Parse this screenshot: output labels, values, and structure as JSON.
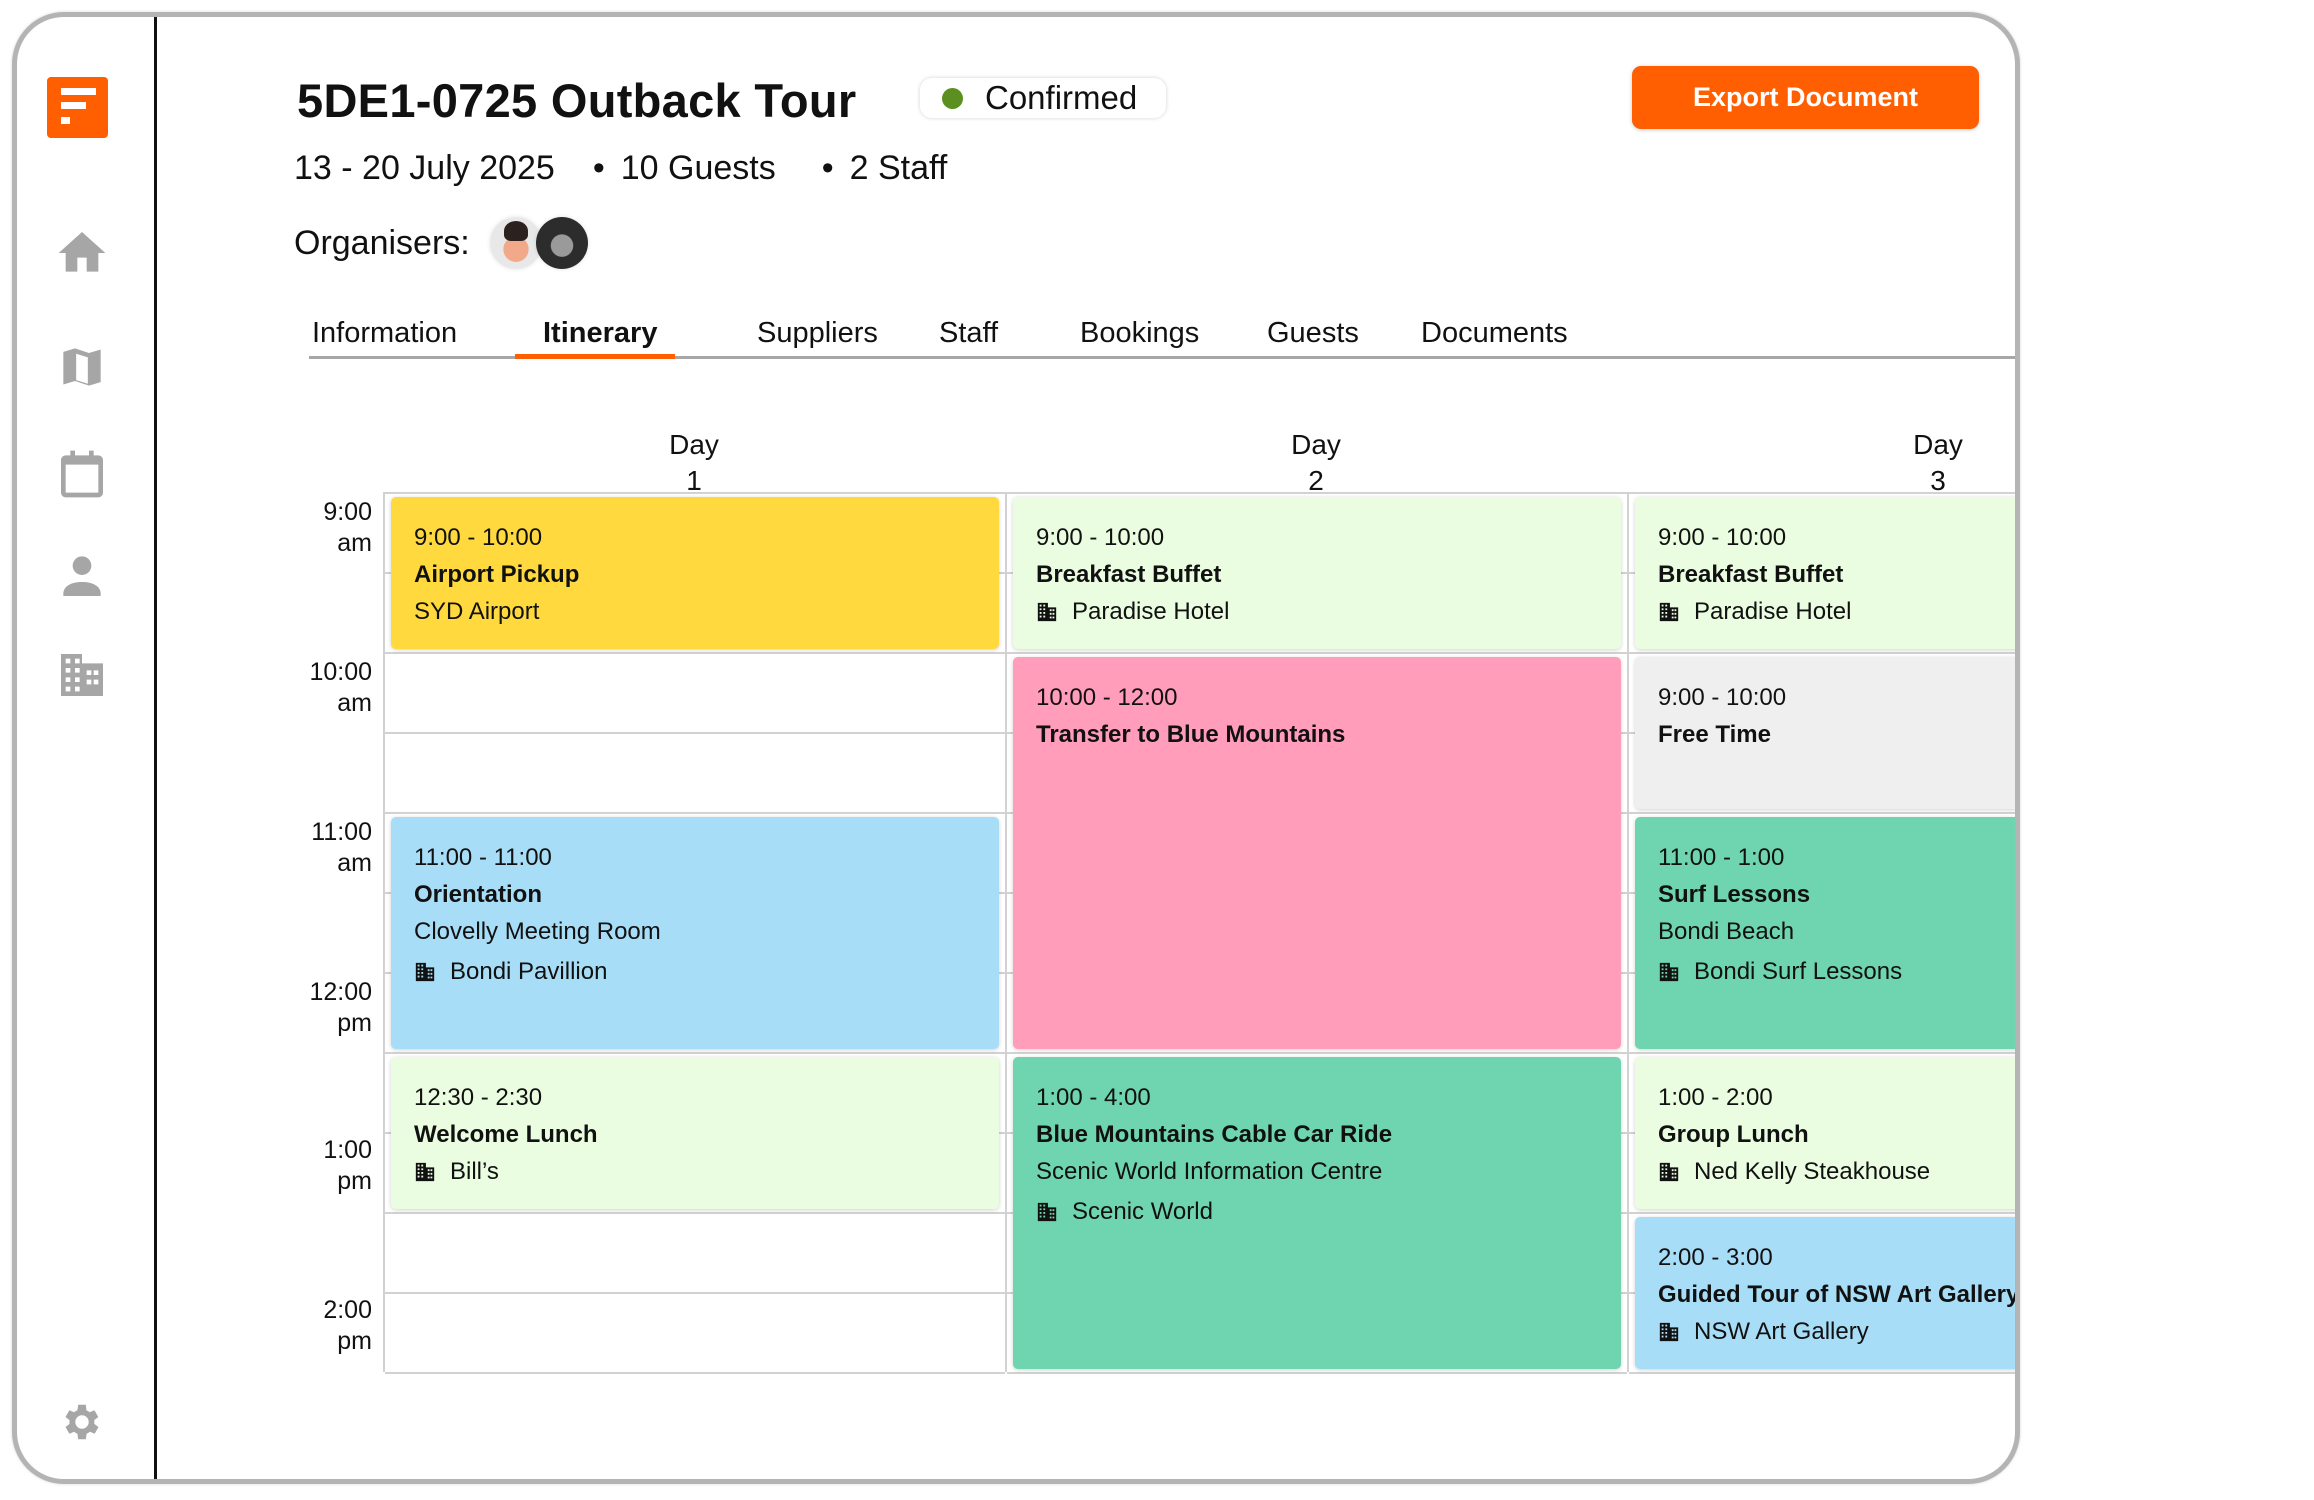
{
  "sidebar": {
    "logo": "brand-logo",
    "items": [
      {
        "name": "home",
        "icon": "home-icon"
      },
      {
        "name": "map",
        "icon": "map-icon"
      },
      {
        "name": "calendar",
        "icon": "calendar-icon"
      },
      {
        "name": "people",
        "icon": "person-icon"
      },
      {
        "name": "suppliers",
        "icon": "building-icon"
      }
    ],
    "settings_icon": "gear-icon"
  },
  "header": {
    "title": "5DE1-0725 Outback Tour",
    "status": {
      "label": "Confirmed",
      "color": "#5b8f1f"
    },
    "dates": "13 - 20 July 2025",
    "guests": "10 Guests",
    "staff": "2 Staff",
    "bullet": "•",
    "organisers_label": "Organisers:",
    "organisers": [
      "organiser-1",
      "organiser-2"
    ],
    "export_label": "Export Document",
    "accent_color": "#ff5f00"
  },
  "tabs": [
    {
      "label": "Information",
      "active": false
    },
    {
      "label": "Itinerary",
      "active": true
    },
    {
      "label": "Suppliers",
      "active": false
    },
    {
      "label": "Staff",
      "active": false
    },
    {
      "label": "Bookings",
      "active": false
    },
    {
      "label": "Guests",
      "active": false
    },
    {
      "label": "Documents",
      "active": false
    }
  ],
  "calendar": {
    "days": [
      {
        "label": "Day",
        "number": "1"
      },
      {
        "label": "Day",
        "number": "2"
      },
      {
        "label": "Day",
        "number": "3"
      }
    ],
    "time_labels": [
      {
        "time": "9:00",
        "period": "am"
      },
      {
        "time": "10:00",
        "period": "am"
      },
      {
        "time": "11:00",
        "period": "am"
      },
      {
        "time": "12:00",
        "period": "pm"
      },
      {
        "time": "1:00",
        "period": "pm"
      },
      {
        "time": "2:00",
        "period": "pm"
      }
    ],
    "visible_range": {
      "start": "9:00",
      "end": "2:30"
    },
    "events": [
      {
        "day": 1,
        "start": 9.0,
        "end": 10.0,
        "time": "9:00 - 10:00",
        "title": "Airport Pickup",
        "location": "SYD Airport",
        "supplier": null,
        "color": "#ffd93d"
      },
      {
        "day": 1,
        "start": 11.0,
        "end": 12.5,
        "time": "11:00 - 11:00",
        "title": "Orientation",
        "location": "Clovelly Meeting Room",
        "supplier": "Bondi Pavillion",
        "color": "#a8ddf7"
      },
      {
        "day": 1,
        "start": 12.5,
        "end": 13.5,
        "time": "12:30 - 2:30",
        "title": "Welcome Lunch",
        "location": null,
        "supplier": "Bill’s",
        "color": "#eafde0"
      },
      {
        "day": 2,
        "start": 9.0,
        "end": 10.0,
        "time": "9:00 - 10:00",
        "title": "Breakfast Buffet",
        "location": null,
        "supplier": "Paradise Hotel",
        "color": "#eafde0"
      },
      {
        "day": 2,
        "start": 10.0,
        "end": 12.5,
        "time": "10:00 - 12:00",
        "title": "Transfer to Blue Mountains",
        "location": null,
        "supplier": null,
        "color": "#ff9dbb"
      },
      {
        "day": 2,
        "start": 12.5,
        "end": 14.5,
        "time": "1:00 - 4:00",
        "title": "Blue Mountains Cable Car Ride",
        "location": "Scenic World Information Centre",
        "supplier": "Scenic World",
        "color": "#6fd4b0"
      },
      {
        "day": 3,
        "start": 9.0,
        "end": 10.0,
        "time": "9:00 - 10:00",
        "title": "Breakfast Buffet",
        "location": null,
        "supplier": "Paradise Hotel",
        "color": "#eafde0"
      },
      {
        "day": 3,
        "start": 10.0,
        "end": 11.0,
        "time": "9:00 - 10:00",
        "title": "Free Time",
        "location": null,
        "supplier": null,
        "color": "#efefef"
      },
      {
        "day": 3,
        "start": 11.0,
        "end": 12.5,
        "time": "11:00 - 1:00",
        "title": "Surf Lessons",
        "location": "Bondi Beach",
        "supplier": "Bondi Surf Lessons",
        "color": "#6fd4b0"
      },
      {
        "day": 3,
        "start": 12.5,
        "end": 13.5,
        "time": "1:00 - 2:00",
        "title": "Group Lunch",
        "location": null,
        "supplier": "Ned Kelly Steakhouse",
        "color": "#eafde0"
      },
      {
        "day": 3,
        "start": 13.5,
        "end": 14.5,
        "time": "2:00 - 3:00",
        "title": "Guided Tour of NSW Art Gallery",
        "location": null,
        "supplier": "NSW Art Gallery",
        "color": "#a8ddf7"
      }
    ]
  }
}
